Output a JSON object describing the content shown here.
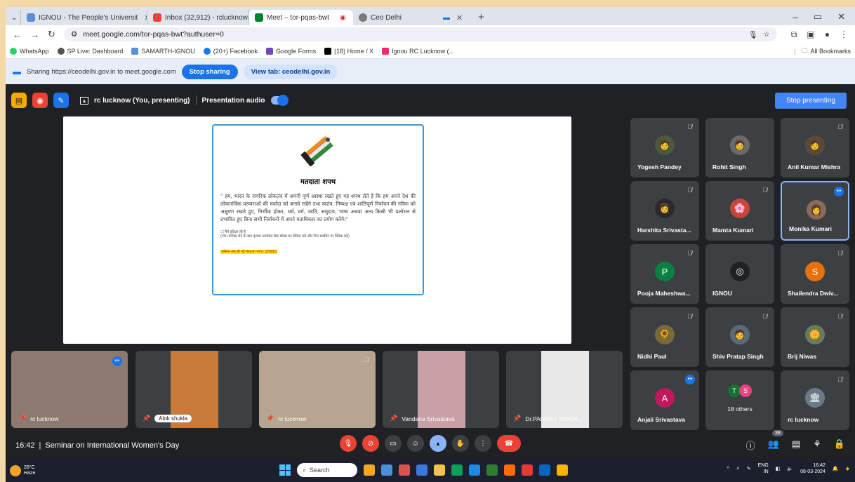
{
  "tabs": [
    {
      "label": "IGNOU - The People's Universit",
      "color": "#5b8fd6"
    },
    {
      "label": "Inbox (32,912) - rclucknow@ig",
      "color": "#ea4335"
    },
    {
      "label": "Meet – tor-pqas-bwt",
      "color": "#00832d"
    },
    {
      "label": "Ceo Delhi",
      "color": "#7a7a7a"
    }
  ],
  "url": "meet.google.com/tor-pqas-bwt?authuser=0",
  "bookmarks": [
    {
      "label": "WhatsApp",
      "color": "#25d366"
    },
    {
      "label": "SP Live: Dashboard",
      "color": "#555555"
    },
    {
      "label": "SAMARTH-IGNOU",
      "color": "#5b8fd6"
    },
    {
      "label": "(20+) Facebook",
      "color": "#1877f2"
    },
    {
      "label": "Google Forms",
      "color": "#7248b9"
    },
    {
      "label": "(18) Home / X",
      "color": "#000000"
    },
    {
      "label": "Ignou RC Lucknow (...",
      "color": "#e1306c"
    }
  ],
  "all_bookmarks": "All Bookmarks",
  "share": {
    "text": "Sharing https://ceodelhi.gov.in to meet.google.com",
    "stop": "Stop sharing",
    "view": "View tab: ceodelhi.gov.in"
  },
  "meet": {
    "presenter": "rc lucknow (You, presenting)",
    "audio": "Presentation audio",
    "stop_presenting": "Stop presenting",
    "time": "16:42",
    "separator": "|",
    "title": "Seminar on International Women's Day",
    "participant_count": "38"
  },
  "slide": {
    "title": "मतदाता शपथ",
    "text": "\" हम, भारत के नागरिक लोकतंत्र में अपनी पूर्ण आस्था रखते हुए यह शपथ लेते है कि हम अपने देश की लोकतांत्रिक परम्पराओं की मर्यादा को बनाये रखेंगे तथा स्वतंत्र, निष्पक्ष एवं शांतिपूर्ण निर्वाचन की गरिमा को अक्षुण्ण रखते हुए, निर्भीक होकर, धर्म, वर्ग, जाति, समुदाय, भाषा अथवा अन्य किसी भी प्रलोभन से प्रभावित हुए बिना सभी निर्वाचनों में अपने मताधिकार का प्रयोग करेंगे।\"",
    "checkbox": "☐ मैंने प्रतिज्ञा ली है",
    "note": "(नोट: प्रतिज्ञा लेने के बाद कृपया उपरोक्त चेक बॉक्स पर क्लिक करें और फिर सबमिट पर क्लिक करें)",
    "count": "वर्तमान तक ली गई मतदाता शपथ: 328083"
  },
  "grid": [
    {
      "name": "Yogesh Pandey",
      "avatar": "🧑",
      "bg": "#4a5a3a",
      "state": "muted"
    },
    {
      "name": "Rohit Singh",
      "avatar": "🧑",
      "bg": "#6a6a6a",
      "state": "none"
    },
    {
      "name": "Anil Kumar Mishra",
      "avatar": "🧑",
      "bg": "#5a4a3a",
      "state": "muted"
    },
    {
      "name": "Harshita Srivasta...",
      "avatar": "👩",
      "bg": "#2a2a2a",
      "state": "muted"
    },
    {
      "name": "Mamta Kumari",
      "avatar": "🌸",
      "bg": "#c9443a",
      "state": "muted"
    },
    {
      "name": "Monika Kumari",
      "avatar": "👩",
      "bg": "#8a6a5a",
      "state": "speaking"
    },
    {
      "name": "Pooja Maheshwa...",
      "avatar": "P",
      "bg": "#0b8043",
      "state": "muted"
    },
    {
      "name": "IGNOU",
      "avatar": "◎",
      "bg": "#202124",
      "state": "none"
    },
    {
      "name": "Shailendra Dwiv...",
      "avatar": "S",
      "bg": "#e8710a",
      "state": "muted"
    },
    {
      "name": "Nidhi Paul",
      "avatar": "🌻",
      "bg": "#7a6a3a",
      "state": "muted"
    },
    {
      "name": "Shiv Pratap Singh",
      "avatar": "🧑",
      "bg": "#5a6a7a",
      "state": "muted"
    },
    {
      "name": "Brij Niwas",
      "avatar": "🌼",
      "bg": "#6a7a5a",
      "state": "muted"
    },
    {
      "name": "Anjali Srivastava",
      "avatar": "A",
      "bg": "#c2185b",
      "state": "speaking"
    },
    {
      "name": "18 others",
      "avatar": "",
      "bg": "",
      "state": "others"
    },
    {
      "name": "rc lucknow",
      "avatar": "🏛",
      "bg": "#6a7a8a",
      "state": "muted"
    }
  ],
  "others_avatars": [
    "T",
    "S"
  ],
  "videos": [
    {
      "name": "rc lucknow",
      "bg": "#8c7a70",
      "state": "speaking"
    },
    {
      "name": "Alok shukla",
      "bg": "#c87a3a",
      "state": "chip"
    },
    {
      "name": "rc lucknow",
      "bg": "#b8a590",
      "state": "muted"
    },
    {
      "name": "Vandana Srivastava",
      "bg": "#c9a0a5",
      "state": "none"
    },
    {
      "name": "Dr.PARWAT SINGH",
      "bg": "#e8e8e8",
      "state": "none"
    }
  ],
  "taskbar": {
    "temp": "28°C",
    "weather": "Haze",
    "search": "Search",
    "lang": "ENG",
    "region": "IN",
    "time": "16:42",
    "date": "08-03-2024",
    "icons": [
      "#f5a623",
      "#4a90d9",
      "#d9534f",
      "#3c78d8",
      "#f2c14e",
      "#0f9d58",
      "#1e88e5",
      "#2e7d32",
      "#ff6d00",
      "#e53935",
      "#0a66c2",
      "#f4b400"
    ]
  }
}
